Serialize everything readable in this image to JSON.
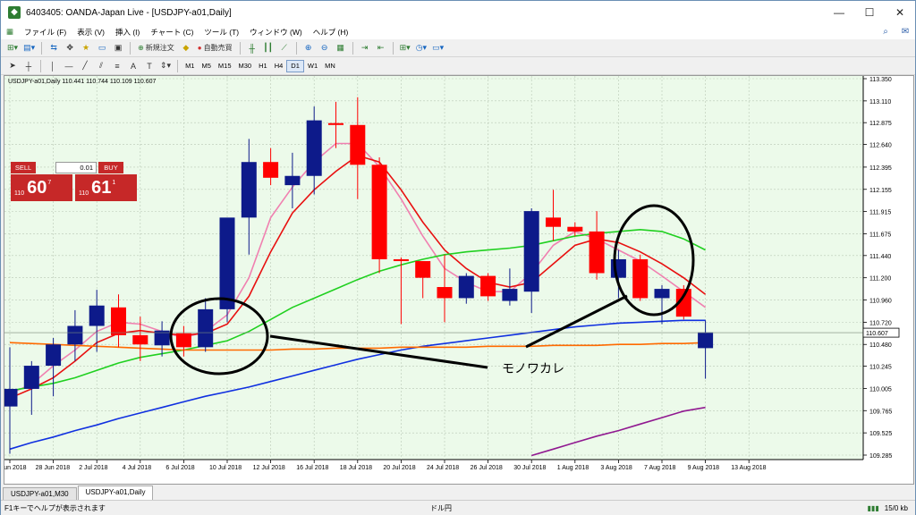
{
  "window": {
    "title": "6403405: OANDA-Japan Live - [USDJPY-a01,Daily]"
  },
  "menu": [
    "ファイル (F)",
    "表示 (V)",
    "挿入 (I)",
    "チャート (C)",
    "ツール (T)",
    "ウィンドウ (W)",
    "ヘルプ (H)"
  ],
  "toolbar": {
    "new_order": "新規注文",
    "auto_trade": "自動売買"
  },
  "timeframes": [
    "M1",
    "M5",
    "M15",
    "M30",
    "H1",
    "H4",
    "D1",
    "W1",
    "MN"
  ],
  "active_timeframe": "D1",
  "trade_panel": {
    "sell": "SELL",
    "buy": "BUY",
    "lot": "0.01",
    "sell_prefix": "110",
    "sell_big": "60",
    "sell_sup": "7",
    "buy_prefix": "110",
    "buy_big": "61",
    "buy_sup": "1"
  },
  "chart_header": "USDJPY-a01,Daily  110.441 110.744 110.109 110.607",
  "annotation": "モノワカレ",
  "tabs": [
    "USDJPY-a01,M30",
    "USDJPY-a01,Daily"
  ],
  "active_tab": 1,
  "status": {
    "help": "F1キーでヘルプが表示されます",
    "profile": "ドル円",
    "traffic": "15/0 kb"
  },
  "colors": {
    "bull": "#0d1a8a",
    "bear": "#ff0000",
    "bg": "#ecfaea",
    "ma_pink": "#f080b0",
    "ma_red": "#e81010",
    "ma_green": "#20d020",
    "ma_blue": "#1030e0",
    "ma_orange": "#ff6a00",
    "ma_purple": "#901890"
  },
  "chart_data": {
    "type": "candlestick",
    "symbol": "USDJPY-a01",
    "timeframe": "Daily",
    "ylim": [
      109.285,
      113.35
    ],
    "price_ticks": [
      "113.350",
      "113.110",
      "112.875",
      "112.640",
      "112.395",
      "112.155",
      "111.915",
      "111.675",
      "111.440",
      "111.200",
      "110.960",
      "110.720",
      "110.480",
      "110.245",
      "110.005",
      "109.765",
      "109.525",
      "109.285"
    ],
    "current_price": "110.607",
    "date_ticks": [
      "26 Jun 2018",
      "28 Jun 2018",
      "2 Jul 2018",
      "4 Jul 2018",
      "6 Jul 2018",
      "10 Jul 2018",
      "12 Jul 2018",
      "16 Jul 2018",
      "18 Jul 2018",
      "20 Jul 2018",
      "24 Jul 2018",
      "26 Jul 2018",
      "30 Jul 2018",
      "1 Aug 2018",
      "3 Aug 2018",
      "7 Aug 2018",
      "9 Aug 2018",
      "13 Aug 2018"
    ],
    "candles": [
      {
        "o": 109.81,
        "h": 110.45,
        "l": 109.3,
        "c": 110.0
      },
      {
        "o": 110.0,
        "h": 110.3,
        "l": 109.72,
        "c": 110.25
      },
      {
        "o": 110.25,
        "h": 110.55,
        "l": 109.92,
        "c": 110.48
      },
      {
        "o": 110.48,
        "h": 110.85,
        "l": 110.3,
        "c": 110.68
      },
      {
        "o": 110.68,
        "h": 111.07,
        "l": 110.4,
        "c": 110.9
      },
      {
        "o": 110.88,
        "h": 111.02,
        "l": 110.45,
        "c": 110.58
      },
      {
        "o": 110.58,
        "h": 110.78,
        "l": 110.3,
        "c": 110.48
      },
      {
        "o": 110.47,
        "h": 110.73,
        "l": 110.35,
        "c": 110.63
      },
      {
        "o": 110.6,
        "h": 110.68,
        "l": 110.35,
        "c": 110.45
      },
      {
        "o": 110.45,
        "h": 110.98,
        "l": 110.4,
        "c": 110.86
      },
      {
        "o": 110.86,
        "h": 111.55,
        "l": 110.72,
        "c": 111.85
      },
      {
        "o": 111.85,
        "h": 112.7,
        "l": 111.45,
        "c": 112.45
      },
      {
        "o": 112.45,
        "h": 112.6,
        "l": 112.2,
        "c": 112.28
      },
      {
        "o": 112.2,
        "h": 112.55,
        "l": 111.95,
        "c": 112.3
      },
      {
        "o": 112.3,
        "h": 113.05,
        "l": 112.1,
        "c": 112.9
      },
      {
        "o": 112.87,
        "h": 113.1,
        "l": 112.6,
        "c": 112.85
      },
      {
        "o": 112.85,
        "h": 113.15,
        "l": 112.05,
        "c": 112.42
      },
      {
        "o": 112.42,
        "h": 112.5,
        "l": 111.25,
        "c": 111.4
      },
      {
        "o": 111.4,
        "h": 111.42,
        "l": 110.7,
        "c": 111.38
      },
      {
        "o": 111.38,
        "h": 111.38,
        "l": 110.98,
        "c": 111.2
      },
      {
        "o": 111.1,
        "h": 111.45,
        "l": 110.72,
        "c": 110.98
      },
      {
        "o": 110.98,
        "h": 111.25,
        "l": 110.92,
        "c": 111.22
      },
      {
        "o": 111.22,
        "h": 111.25,
        "l": 110.95,
        "c": 111.0
      },
      {
        "o": 110.95,
        "h": 111.3,
        "l": 110.9,
        "c": 111.08
      },
      {
        "o": 111.05,
        "h": 111.95,
        "l": 110.82,
        "c": 111.92
      },
      {
        "o": 111.85,
        "h": 112.15,
        "l": 111.6,
        "c": 111.75
      },
      {
        "o": 111.75,
        "h": 111.8,
        "l": 111.65,
        "c": 111.7
      },
      {
        "o": 111.7,
        "h": 111.92,
        "l": 111.18,
        "c": 111.25
      },
      {
        "o": 111.2,
        "h": 111.5,
        "l": 110.98,
        "c": 111.4
      },
      {
        "o": 111.4,
        "h": 111.45,
        "l": 110.95,
        "c": 110.98
      },
      {
        "o": 110.98,
        "h": 111.12,
        "l": 110.7,
        "c": 111.08
      },
      {
        "o": 111.08,
        "h": 111.12,
        "l": 110.75,
        "c": 110.78
      },
      {
        "o": 110.44,
        "h": 110.74,
        "l": 110.11,
        "c": 110.61
      }
    ],
    "ma": [
      {
        "name": "pink",
        "color": "#f080b0",
        "values": [
          109.95,
          110.05,
          110.25,
          110.42,
          110.62,
          110.72,
          110.7,
          110.62,
          110.55,
          110.62,
          110.8,
          111.2,
          111.85,
          112.18,
          112.45,
          112.65,
          112.65,
          112.4,
          112.05,
          111.65,
          111.3,
          111.15,
          111.05,
          111.05,
          111.25,
          111.55,
          111.7,
          111.62,
          111.5,
          111.38,
          111.22,
          111.05,
          110.88
        ]
      },
      {
        "name": "red",
        "color": "#e81010",
        "values": [
          109.9,
          110.0,
          110.12,
          110.3,
          110.5,
          110.6,
          110.63,
          110.6,
          110.58,
          110.6,
          110.7,
          111.0,
          111.48,
          111.9,
          112.15,
          112.35,
          112.52,
          112.45,
          112.15,
          111.8,
          111.5,
          111.3,
          111.15,
          111.1,
          111.15,
          111.35,
          111.55,
          111.62,
          111.58,
          111.48,
          111.35,
          111.2,
          111.02
        ]
      },
      {
        "name": "green",
        "color": "#20d020",
        "values": [
          109.98,
          110.02,
          110.06,
          110.12,
          110.2,
          110.28,
          110.34,
          110.38,
          110.42,
          110.47,
          110.52,
          110.62,
          110.75,
          110.88,
          110.98,
          111.08,
          111.18,
          111.27,
          111.34,
          111.4,
          111.45,
          111.48,
          111.5,
          111.52,
          111.55,
          111.6,
          111.65,
          111.68,
          111.7,
          111.72,
          111.7,
          111.62,
          111.5
        ]
      },
      {
        "name": "blue",
        "color": "#1030e0",
        "values": [
          109.35,
          109.42,
          109.48,
          109.55,
          109.61,
          109.68,
          109.74,
          109.8,
          109.86,
          109.92,
          109.97,
          110.02,
          110.08,
          110.14,
          110.2,
          110.26,
          110.32,
          110.37,
          110.42,
          110.46,
          110.49,
          110.52,
          110.55,
          110.58,
          110.61,
          110.64,
          110.67,
          110.69,
          110.71,
          110.72,
          110.73,
          110.74,
          110.74
        ]
      },
      {
        "name": "orange",
        "color": "#ff6a00",
        "values": [
          110.5,
          110.49,
          110.48,
          110.47,
          110.46,
          110.45,
          110.44,
          110.43,
          110.42,
          110.42,
          110.42,
          110.42,
          110.42,
          110.43,
          110.43,
          110.44,
          110.44,
          110.44,
          110.45,
          110.45,
          110.45,
          110.45,
          110.46,
          110.46,
          110.46,
          110.47,
          110.47,
          110.47,
          110.48,
          110.48,
          110.49,
          110.49,
          110.5
        ]
      },
      {
        "name": "purple",
        "color": "#901890",
        "start": 24,
        "values": [
          109.28,
          109.35,
          109.42,
          109.49,
          109.55,
          109.62,
          109.69,
          109.76,
          109.8
        ]
      }
    ],
    "grid": true
  }
}
